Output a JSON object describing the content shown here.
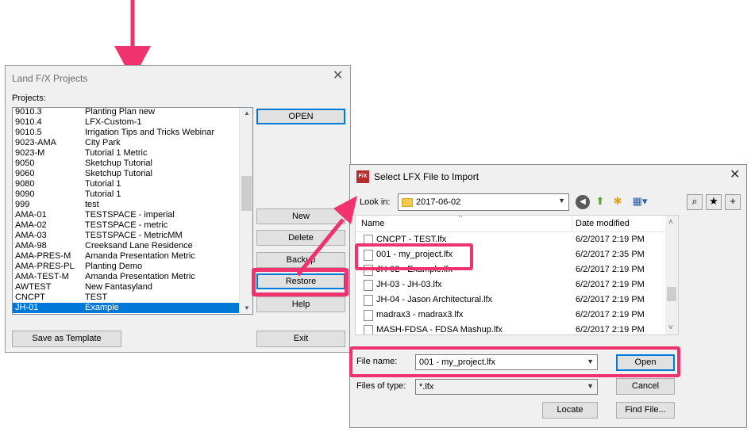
{
  "projects_dialog": {
    "title": "Land F/X Projects",
    "close": "✕",
    "projects_label": "Projects:",
    "projects": [
      {
        "id": "9010.3",
        "name": "Planting Plan new"
      },
      {
        "id": "9010.4",
        "name": "LFX-Custom-1"
      },
      {
        "id": "9010.5",
        "name": "Irrigation Tips and Tricks Webinar"
      },
      {
        "id": "9023-AMA",
        "name": "City Park"
      },
      {
        "id": "9023-M",
        "name": "Tutorial 1 Metric"
      },
      {
        "id": "9050",
        "name": "Sketchup Tutorial"
      },
      {
        "id": "9060",
        "name": "Sketchup Tutorial"
      },
      {
        "id": "9080",
        "name": "Tutorial 1"
      },
      {
        "id": "9090",
        "name": "Tutorial 1"
      },
      {
        "id": "999",
        "name": "test"
      },
      {
        "id": "AMA-01",
        "name": "TESTSPACE - imperial"
      },
      {
        "id": "AMA-02",
        "name": "TESTSPACE - metric"
      },
      {
        "id": "AMA-03",
        "name": "TESTSPACE - MetricMM"
      },
      {
        "id": "AMA-98",
        "name": "Creeksand Lane Residence"
      },
      {
        "id": "AMA-PRES-M",
        "name": "Amanda Presentation Metric"
      },
      {
        "id": "AMA-PRES-PL",
        "name": "Planting Demo"
      },
      {
        "id": "AMA-TEST-M",
        "name": "Amanda Presentation Metric"
      },
      {
        "id": "AWTEST",
        "name": "New Fantasyland"
      },
      {
        "id": "CNCPT",
        "name": "TEST"
      },
      {
        "id": "JH-01",
        "name": "Example",
        "selected": true
      }
    ],
    "buttons": {
      "open": "OPEN",
      "new": "New",
      "delete": "Delete",
      "backup": "Backup",
      "restore": "Restore",
      "help": "Help",
      "save_template": "Save as Template",
      "exit": "Exit"
    }
  },
  "import_dialog": {
    "icon": "F/X",
    "title": "Select LFX File to Import",
    "close": "✕",
    "look_in_label": "Look in:",
    "look_in_value": "2017-06-02",
    "columns": {
      "name": "Name",
      "date": "Date modified"
    },
    "files": [
      {
        "name": "CNCPT - TEST.lfx",
        "date": "6/2/2017 2:19 PM"
      },
      {
        "name": "001 - my_project.lfx",
        "date": "6/2/2017 2:35 PM"
      },
      {
        "name": "JH-02 - Example.lfx",
        "date": "6/2/2017 2:19 PM"
      },
      {
        "name": "JH-03 - JH-03.lfx",
        "date": "6/2/2017 2:19 PM"
      },
      {
        "name": "JH-04 - Jason Architectural.lfx",
        "date": "6/2/2017 2:19 PM"
      },
      {
        "name": "madrax3 - madrax3.lfx",
        "date": "6/2/2017 2:19 PM"
      },
      {
        "name": "MASH-FDSA - FDSA Mashup.lfx",
        "date": "6/2/2017 2:19 PM"
      }
    ],
    "file_name_label": "File name:",
    "file_name_value": "001 - my_project.lfx",
    "files_of_type_label": "Files of type:",
    "files_of_type_value": "*.lfx",
    "buttons": {
      "open": "Open",
      "cancel": "Cancel",
      "locate": "Locate",
      "find_file": "Find File..."
    }
  },
  "colors": {
    "highlight": "#f0336e",
    "selection": "#0078d7"
  }
}
